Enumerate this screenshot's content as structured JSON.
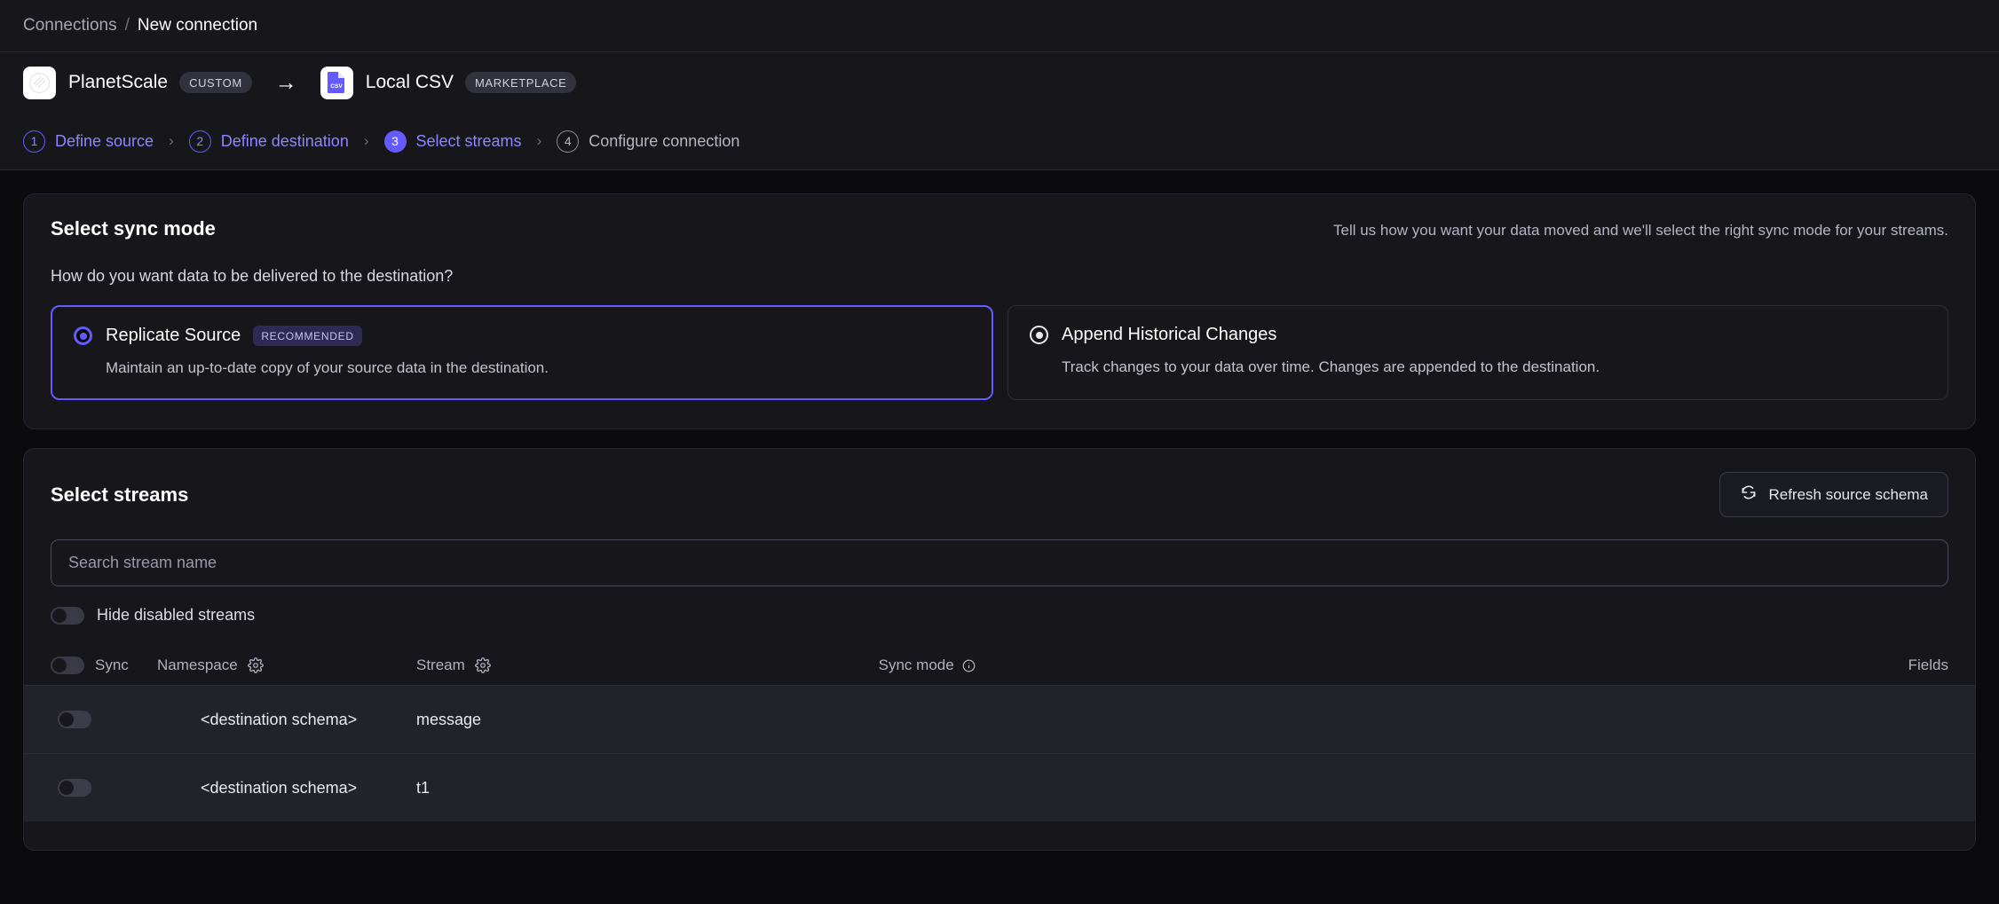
{
  "breadcrumb": {
    "root": "Connections",
    "separator": "/",
    "current": "New connection"
  },
  "connection_header": {
    "source": {
      "name": "PlanetScale",
      "tag": "CUSTOM",
      "icon": "planetscale-logo"
    },
    "arrow": "→",
    "destination": {
      "name": "Local CSV",
      "tag": "MARKETPLACE",
      "icon": "csv-file-icon"
    }
  },
  "steps": [
    {
      "num": "1",
      "label": "Define source",
      "state": "done"
    },
    {
      "num": "2",
      "label": "Define destination",
      "state": "done"
    },
    {
      "num": "3",
      "label": "Select streams",
      "state": "active"
    },
    {
      "num": "4",
      "label": "Configure connection",
      "state": "todo"
    }
  ],
  "step_chevron": "›",
  "sync_mode": {
    "title": "Select sync mode",
    "hint": "Tell us how you want your data moved and we'll select the right sync mode for your streams.",
    "question": "How do you want data to be delivered to the destination?",
    "options": [
      {
        "title": "Replicate Source",
        "badge": "RECOMMENDED",
        "description": "Maintain an up-to-date copy of your source data in the destination.",
        "selected": true
      },
      {
        "title": "Append Historical Changes",
        "badge": "",
        "description": "Track changes to your data over time. Changes are appended to the destination.",
        "selected": false
      }
    ]
  },
  "streams": {
    "title": "Select streams",
    "refresh_label": "Refresh source schema",
    "search_placeholder": "Search stream name",
    "search_value": "",
    "hide_disabled_label": "Hide disabled streams",
    "hide_disabled_on": false,
    "columns": {
      "sync": "Sync",
      "namespace": "Namespace",
      "stream": "Stream",
      "sync_mode": "Sync mode",
      "fields": "Fields"
    },
    "rows": [
      {
        "namespace": "<destination schema>",
        "stream": "message",
        "enabled": false
      },
      {
        "namespace": "<destination schema>",
        "stream": "t1",
        "enabled": false
      }
    ]
  },
  "colors": {
    "accent": "#635bff",
    "page_bg": "#0b0b0e",
    "card_bg": "#16161b",
    "row_bg": "#22222b"
  }
}
